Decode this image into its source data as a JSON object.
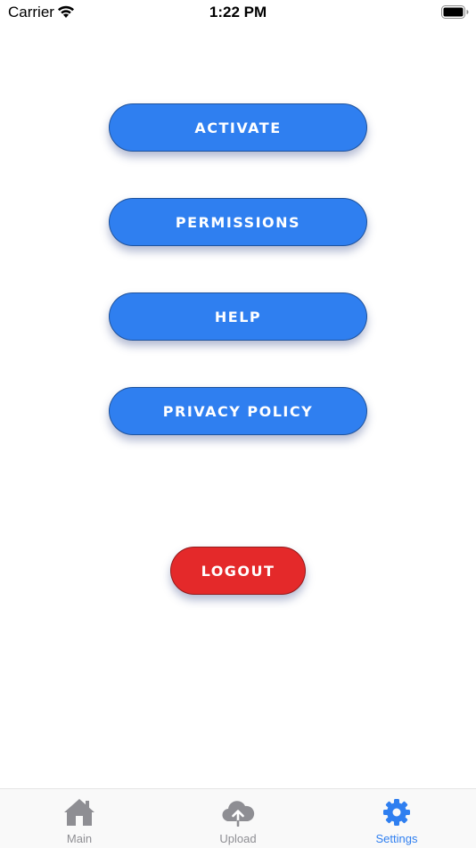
{
  "status_bar": {
    "carrier": "Carrier",
    "time": "1:22 PM",
    "icons": [
      "wifi-icon",
      "battery-icon"
    ]
  },
  "colors": {
    "primary_button": "#2f7ff0",
    "logout_button": "#e4292a",
    "active_tab": "#2f7ff0",
    "inactive_tab": "#8e8e93"
  },
  "actions": {
    "activate": "ACTIVATE",
    "permissions": "PERMISSIONS",
    "help": "HELP",
    "privacy_policy": "PRIVACY POLICY",
    "logout": "LOGOUT"
  },
  "tab_bar": {
    "active": "settings",
    "tabs": [
      {
        "id": "main",
        "label": "Main",
        "icon": "home-icon"
      },
      {
        "id": "upload",
        "label": "Upload",
        "icon": "cloud-upload-icon"
      },
      {
        "id": "settings",
        "label": "Settings",
        "icon": "gear-icon"
      }
    ]
  }
}
